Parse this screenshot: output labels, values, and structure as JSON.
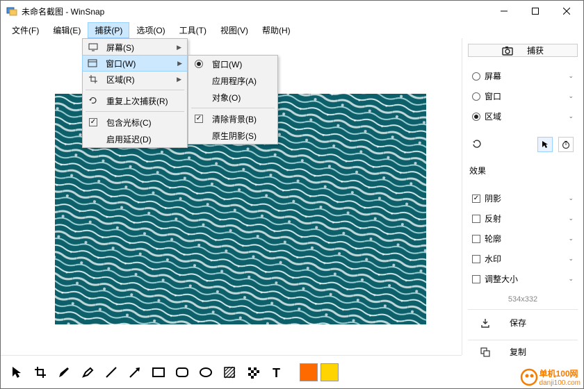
{
  "window": {
    "title": "未命名截图 - WinSnap"
  },
  "menu": {
    "file": "文件(F)",
    "edit": "编辑(E)",
    "capture": "捕获(P)",
    "options": "选项(O)",
    "tools": "工具(T)",
    "view": "视图(V)",
    "help": "帮助(H)"
  },
  "captureMenu": {
    "screen": "屏幕(S)",
    "window": "窗口(W)",
    "region": "区域(R)",
    "repeat": "重复上次捕获(R)",
    "cursor": "包含光标(C)",
    "delay": "启用延迟(D)"
  },
  "windowSub": {
    "window": "窗口(W)",
    "app": "应用程序(A)",
    "object": "对象(O)",
    "clearbg": "清除背景(B)",
    "native": "原生阴影(S)"
  },
  "side": {
    "capture": "捕获",
    "screen": "屏幕",
    "window": "窗口",
    "region": "区域",
    "effects": "效果",
    "shadow": "阴影",
    "reflect": "反射",
    "outline": "轮廓",
    "watermark": "水印",
    "resize": "调整大小",
    "dim": "534x332",
    "save": "保存",
    "copy": "复制"
  },
  "watermark": {
    "site": "单机100网",
    "url": "danji100.com"
  }
}
